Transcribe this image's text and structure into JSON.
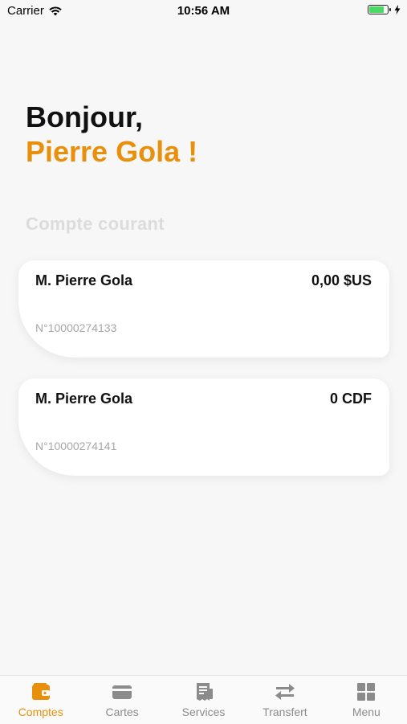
{
  "status_bar": {
    "carrier": "Carrier",
    "time": "10:56 AM",
    "battery_level": 0.85
  },
  "greeting": {
    "hello": "Bonjour,",
    "name": "Pierre Gola !"
  },
  "section_title": "Compte courant",
  "accounts": [
    {
      "holder": "M. Pierre Gola",
      "balance": "0,00 $US",
      "number": "N°10000274133"
    },
    {
      "holder": "M. Pierre Gola",
      "balance": "0 CDF",
      "number": "N°10000274141"
    }
  ],
  "tab_bar": {
    "active_color": "#e8900c",
    "items": [
      {
        "label": "Comptes",
        "icon": "wallet-icon",
        "active": true
      },
      {
        "label": "Cartes",
        "icon": "card-icon",
        "active": false
      },
      {
        "label": "Services",
        "icon": "receipt-icon",
        "active": false
      },
      {
        "label": "Transfert",
        "icon": "transfer-arrows-icon",
        "active": false
      },
      {
        "label": "Menu",
        "icon": "grid-icon",
        "active": false
      }
    ]
  }
}
